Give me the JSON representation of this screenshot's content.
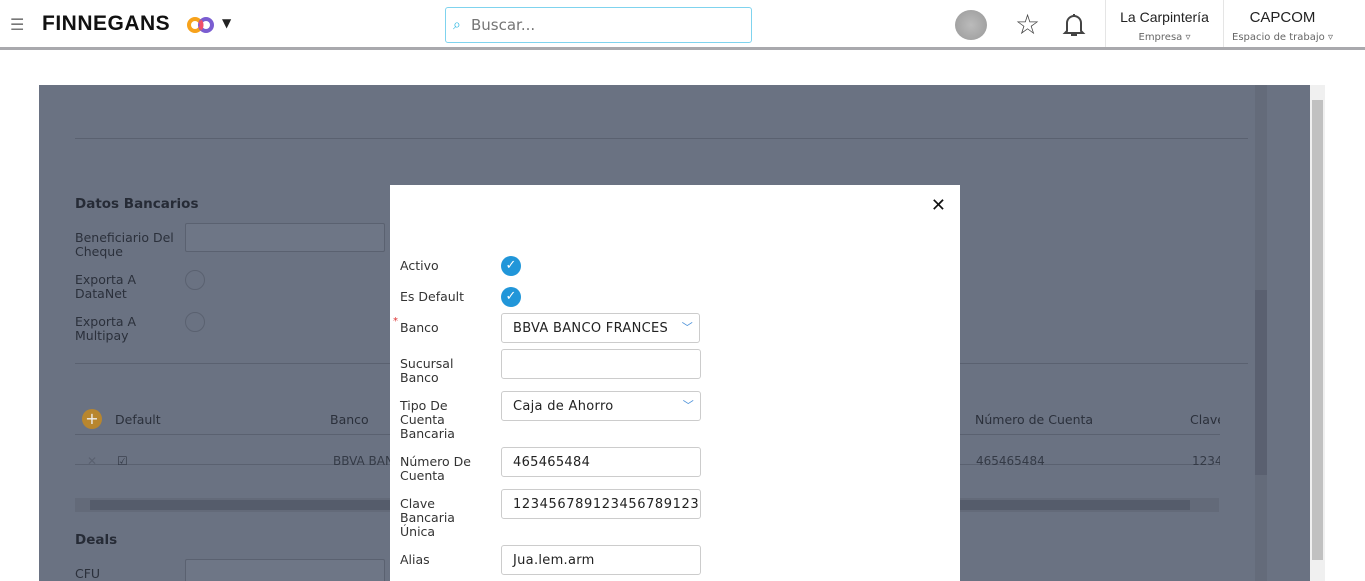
{
  "header": {
    "brand": "FINNEGANS",
    "search_placeholder": "Buscar...",
    "company": "La Carpintería",
    "company_label": "Empresa",
    "workspace": "CAPCOM",
    "workspace_label": "Espacio de trabajo"
  },
  "background": {
    "section_bank": "Datos Bancarios",
    "fields": [
      "Beneficiario Del Cheque",
      "Exporta A DataNet",
      "Exporta A Multipay"
    ],
    "table": {
      "headers": [
        "Default",
        "Banco",
        "Número de Cuenta",
        "Clave"
      ],
      "row": {
        "banco": "BBVA BAN",
        "numero": "465465484",
        "clave": "1234"
      }
    },
    "section_deals": "Deals",
    "cfu_label": "CFU"
  },
  "modal": {
    "activo_label": "Activo",
    "default_label": "Es Default",
    "banco_label": "Banco",
    "banco_value": "BBVA BANCO FRANCES S",
    "sucursal_label": "Sucursal Banco",
    "sucursal_value": "",
    "tipo_label": "Tipo De Cuenta Bancaria",
    "tipo_value": "Caja de Ahorro",
    "numero_label": "Número De Cuenta",
    "numero_value": "465465484",
    "clave_label": "Clave Bancaria Única",
    "clave_value": "12345678912345678912​3",
    "alias_label": "Alias",
    "alias_value": "Jua.lem.arm"
  }
}
